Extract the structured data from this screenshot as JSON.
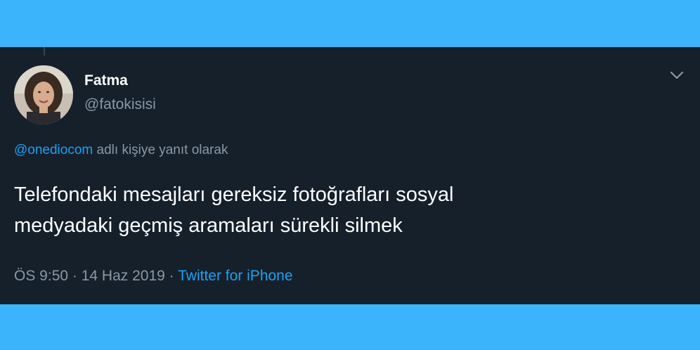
{
  "tweet": {
    "author_name": "Fatma",
    "author_handle": "@fatokisisi",
    "reply_mention": "@onediocom",
    "reply_suffix": " adlı kişiye yanıt olarak",
    "text_line1": "Telefondaki mesajları gereksiz fotoğrafları sosyal",
    "text_line2": "medyadaki geçmiş aramaları sürekli silmek",
    "time": "ÖS 9:50",
    "separator1": " · ",
    "date": "14 Haz 2019",
    "separator2": " · ",
    "source": "Twitter for iPhone"
  },
  "icons": {
    "menu": "chevron-down-icon",
    "avatar": "profile-photo"
  },
  "colors": {
    "page_background": "#3cb4fb",
    "card_background": "#15202b",
    "primary_text": "#ffffff",
    "secondary_text": "#8899a6",
    "link": "#1da1f2"
  }
}
